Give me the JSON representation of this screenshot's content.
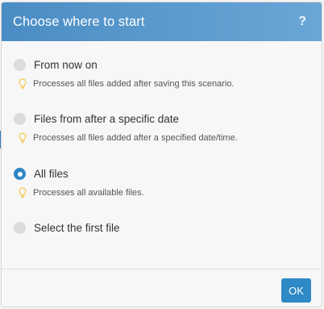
{
  "dialog": {
    "title": "Choose where to start",
    "help_symbol": "?"
  },
  "options": [
    {
      "label": "From now on",
      "hint": "Processes all files added after saving this scenario.",
      "selected": false
    },
    {
      "label": "Files from after a specific date",
      "hint": "Processes all files added after a specified date/time.",
      "selected": false
    },
    {
      "label": "All files",
      "hint": "Processes all available files.",
      "selected": true
    },
    {
      "label": "Select the first file",
      "hint": "",
      "selected": false
    }
  ],
  "footer": {
    "ok_label": "OK"
  },
  "colors": {
    "header_start": "#4a8dc4",
    "header_end": "#6aa6d6",
    "accent": "#2f86c5",
    "bulb": "#f2c94c"
  },
  "icons": {
    "help": "question-mark-icon",
    "hint": "lightbulb-icon"
  }
}
